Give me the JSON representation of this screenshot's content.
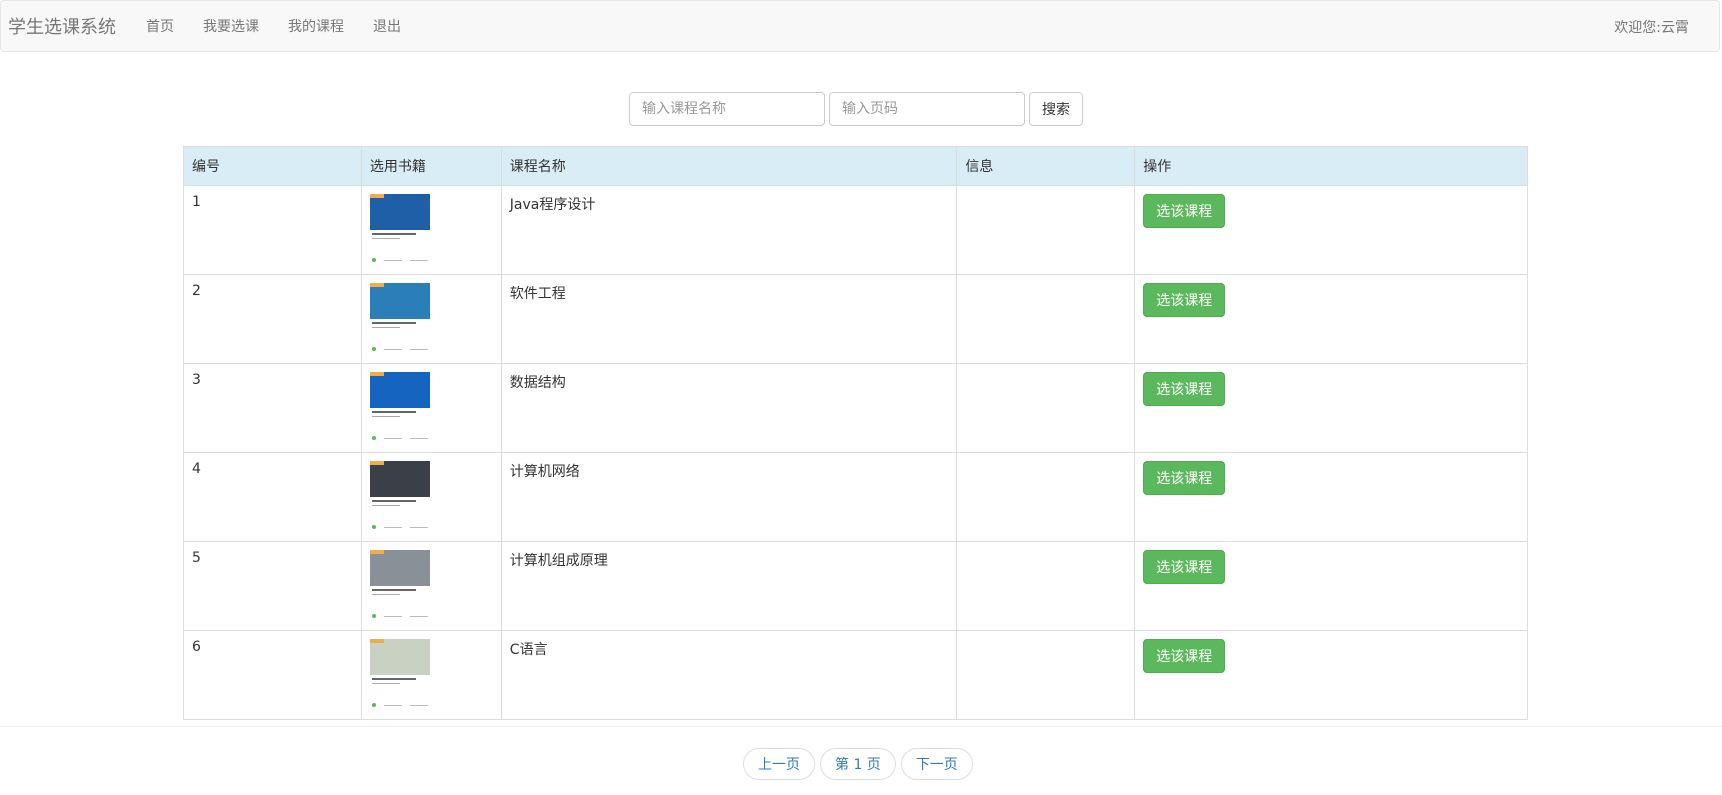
{
  "navbar": {
    "brand": "学生选课系统",
    "links": [
      "首页",
      "我要选课",
      "我的课程",
      "退出"
    ],
    "welcome": "欢迎您:云霄"
  },
  "search": {
    "name_placeholder": "输入课程名称",
    "page_placeholder": "输入页码",
    "button_label": "搜索"
  },
  "table": {
    "headers": [
      "编号",
      "选用书籍",
      "课程名称",
      "信息",
      "操作"
    ],
    "rows": [
      {
        "id": "1",
        "name": "Java程序设计",
        "info": "",
        "action": "选该课程",
        "cover_color": "#1f5fa8"
      },
      {
        "id": "2",
        "name": "软件工程",
        "info": "",
        "action": "选该课程",
        "cover_color": "#2a7fb8"
      },
      {
        "id": "3",
        "name": "数据结构",
        "info": "",
        "action": "选该课程",
        "cover_color": "#1565c0"
      },
      {
        "id": "4",
        "name": "计算机网络",
        "info": "",
        "action": "选该课程",
        "cover_color": "#3b4048"
      },
      {
        "id": "5",
        "name": "计算机组成原理",
        "info": "",
        "action": "选该课程",
        "cover_color": "#8a9098"
      },
      {
        "id": "6",
        "name": "C语言",
        "info": "",
        "action": "选该课程",
        "cover_color": "#c9d2c2"
      }
    ]
  },
  "pager": {
    "prev": "上一页",
    "current": "第 1 页",
    "next": "下一页"
  },
  "colors": {
    "header_bg": "#d9edf7",
    "button_green": "#5cb85c",
    "link_blue": "#337ab7"
  }
}
